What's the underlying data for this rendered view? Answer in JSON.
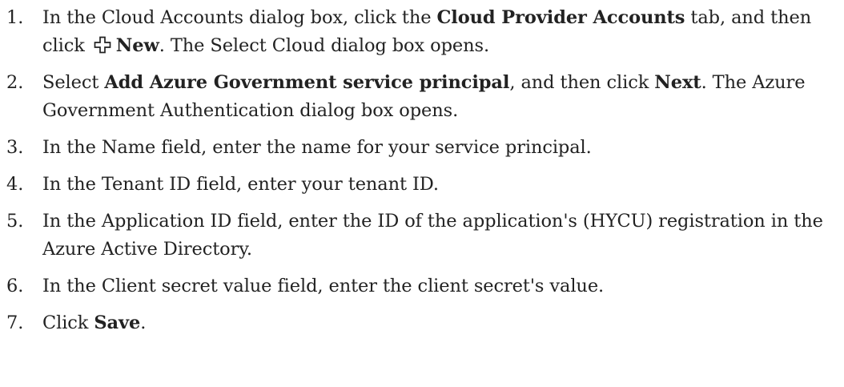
{
  "steps": [
    {
      "number": "1.",
      "t1": "In the Cloud Accounts dialog box, click the ",
      "b1": "Cloud Provider Accounts",
      "t2": " tab, and then click ",
      "b2": "New",
      "t3": ". The Select Cloud dialog box opens.",
      "icon": "plus-outline-icon"
    },
    {
      "number": "2.",
      "t1": "Select ",
      "b1": "Add Azure Government service principal",
      "t2": ", and then click ",
      "b2": "Next",
      "t3": ". The Azure Government Authentication dialog box opens."
    },
    {
      "number": "3.",
      "text": "In the Name field, enter the name for your service principal."
    },
    {
      "number": "4.",
      "text": "In the Tenant ID field, enter your tenant ID."
    },
    {
      "number": "5.",
      "text": "In the Application ID field, enter the ID of the application's (HYCU) registration in the Azure Active Directory."
    },
    {
      "number": "6.",
      "text": "In the Client secret value field, enter the client secret's value."
    },
    {
      "number": "7.",
      "t1": "Click ",
      "b1": "Save",
      "t2": "."
    }
  ]
}
